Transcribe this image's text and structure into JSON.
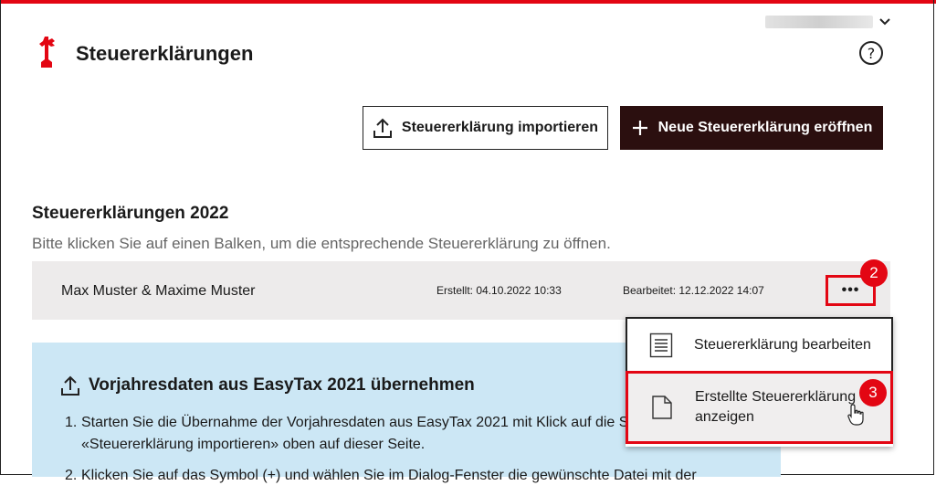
{
  "header": {
    "title": "Steuererklärungen",
    "user_name": "",
    "help_label": "?"
  },
  "toolbar": {
    "import_label": "Steuererklärung importieren",
    "new_label": "Neue Steuererklärung eröffnen"
  },
  "section": {
    "title": "Steuererklärungen 2022",
    "hint": "Bitte klicken Sie auf einen Balken, um die entsprechende Steuererklärung zu öffnen."
  },
  "row": {
    "name": "Max Muster & Maxime Muster",
    "created": "Erstellt: 04.10.2022 10:33",
    "edited": "Bearbeitet: 12.12.2022 14:07",
    "more_label": "•••"
  },
  "badges": {
    "two": "2",
    "three": "3"
  },
  "menu": {
    "edit_label": "Steuererklärung bearbeiten",
    "view_line1": "Erstellte Steuererklärung",
    "view_line2": "anzeigen"
  },
  "info": {
    "title": "Vorjahresdaten aus EasyTax 2021 übernehmen",
    "items": [
      {
        "num": "1.",
        "line1": "Starten Sie die Übernahme der Vorjahresdaten aus EasyTax 2021 mit Klick auf die Schaltfläche",
        "line2": "«Steuererklärung importieren» oben auf dieser Seite."
      },
      {
        "num": "2.",
        "line1": "Klicken Sie auf das Symbol (+) und wählen Sie im Dialog-Fenster die gewünschte Datei mit der"
      }
    ]
  },
  "colors": {
    "accent_red": "#e30613",
    "dark_button": "#2b0f0f",
    "info_bg": "#cce7f5",
    "row_bg": "#edebeb"
  }
}
